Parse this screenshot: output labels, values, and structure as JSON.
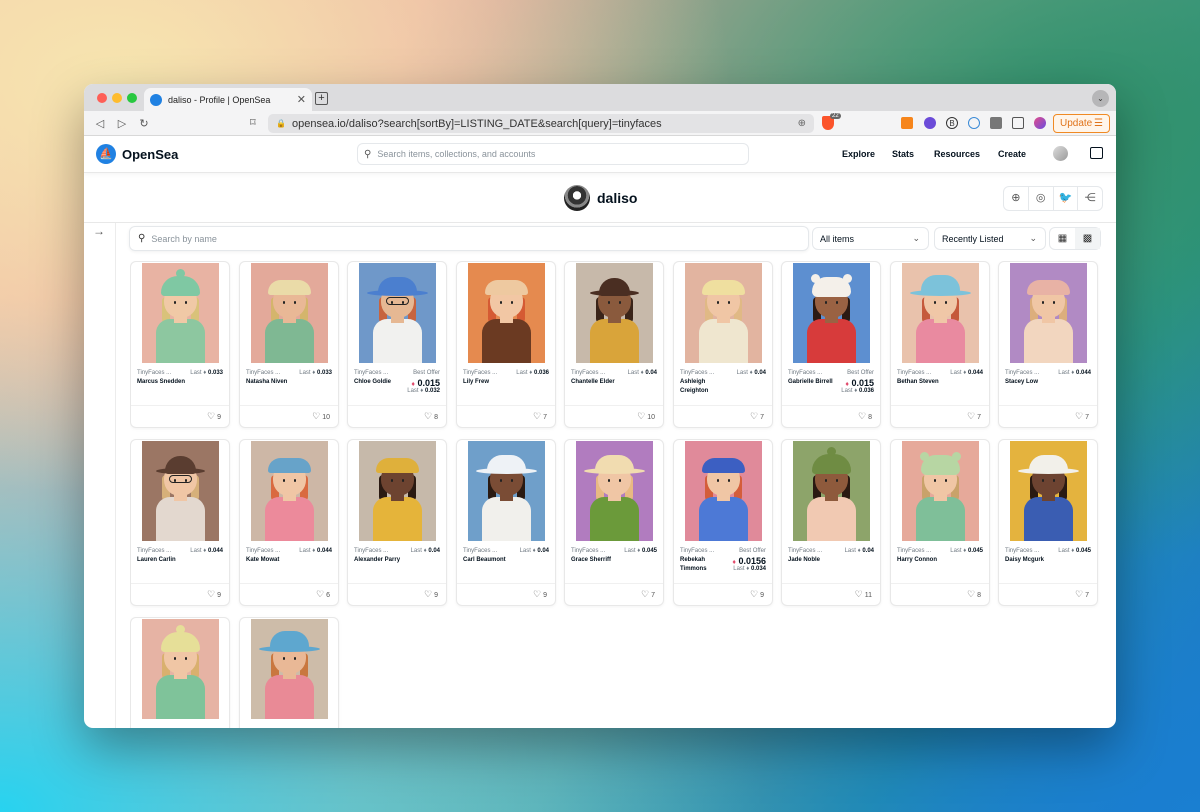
{
  "browser": {
    "tab_title": "daliso - Profile | OpenSea",
    "tab_close": "✕",
    "new_tab": "+",
    "url": "opensea.io/daliso?search[sortBy]=LISTING_DATE&search[query]=tinyfaces",
    "brave_count": "22",
    "update_label": "Update",
    "menu_glyph": "☰",
    "ext_b_letter": "B"
  },
  "header": {
    "brand": "OpenSea",
    "search_placeholder": "Search items, collections, and accounts",
    "nav": [
      "Explore",
      "Stats",
      "Resources",
      "Create"
    ]
  },
  "profile": {
    "name": "daliso"
  },
  "filters": {
    "search_placeholder": "Search by name",
    "items_filter": "All items",
    "sort": "Recently Listed"
  },
  "icons": {
    "back": "◁",
    "forward": "▷",
    "reload": "↻",
    "bookmark": "⌑",
    "lock": "🔒",
    "zoom": "⊕",
    "search": "⚲",
    "globe": "⊕",
    "instagram": "◎",
    "twitter": "🐦",
    "share": "⋲",
    "expand": "→",
    "chevron": "⌄",
    "heart": "♡",
    "eth": "♦",
    "tab_menu": "⌄",
    "grid_large": "▦",
    "grid_small": "▩"
  },
  "card_labels": {
    "last": "Last",
    "best_offer": "Best Offer"
  },
  "cards": [
    {
      "collection": "TinyFaces ...",
      "name": "Marcus Snedden",
      "type": "last",
      "price": "0.033",
      "likes": "9",
      "bg": "#e8b3a3",
      "skin": "#f0c9a6",
      "shirt": "#8dc7a0",
      "hair": "#d9c27a",
      "hat": "#7fc8a3",
      "hatStyle": "beanie"
    },
    {
      "collection": "TinyFaces ...",
      "name": "Natasha Niven",
      "type": "last",
      "price": "0.033",
      "likes": "10",
      "bg": "#e3a99a",
      "skin": "#e9b896",
      "shirt": "#7fb893",
      "hair": "#d4b56c",
      "hat": "#eadba8",
      "hatStyle": "beret"
    },
    {
      "collection": "TinyFaces ...",
      "name": "Chloe Goldie",
      "type": "offer",
      "price": "0.015",
      "sub": "0.032",
      "likes": "8",
      "bg": "#6f98c9",
      "skin": "#e6b893",
      "shirt": "#f1f1ef",
      "hair": "#c7643f",
      "hat": "#4b7fcf",
      "hatStyle": "wide",
      "glasses": true
    },
    {
      "collection": "TinyFaces ...",
      "name": "Lily Frew",
      "type": "last",
      "price": "0.036",
      "likes": "7",
      "bg": "#e58a4f",
      "skin": "#f2c7a4",
      "shirt": "#6b3a22",
      "hair": "#d55a33",
      "hat": "#eec9a0",
      "hatStyle": "cap"
    },
    {
      "collection": "TinyFaces ...",
      "name": "Chantelle Elder",
      "type": "last",
      "price": "0.04",
      "likes": "10",
      "bg": "#c7b9aa",
      "skin": "#8a5a3d",
      "shirt": "#d9a43a",
      "hair": "#3a2419",
      "hat": "#4a2e22",
      "hatStyle": "bowler"
    },
    {
      "collection": "TinyFaces ...",
      "name": "Ashleigh Creighton",
      "type": "last",
      "price": "0.04",
      "likes": "7",
      "bg": "#e2b4a0",
      "skin": "#f0c6a5",
      "shirt": "#efe6cf",
      "hair": "#e0b985",
      "hat": "#efdf9f",
      "hatStyle": "cap"
    },
    {
      "collection": "TinyFaces ...",
      "name": "Gabrielle Birrell",
      "type": "offer",
      "price": "0.015",
      "sub": "0.036",
      "likes": "8",
      "bg": "#5d8fd0",
      "skin": "#9a6243",
      "shirt": "#d73b3b",
      "hair": "#2b1a13",
      "hat": "#f4f0ea",
      "hatStyle": "bear"
    },
    {
      "collection": "TinyFaces ...",
      "name": "Bethan Steven",
      "type": "last",
      "price": "0.044",
      "likes": "7",
      "bg": "#e9c2ac",
      "skin": "#f0c7a7",
      "shirt": "#e98aa0",
      "hair": "#c5593b",
      "hat": "#7cc2da",
      "hatStyle": "bucket"
    },
    {
      "collection": "TinyFaces ...",
      "name": "Stacey Low",
      "type": "last",
      "price": "0.044",
      "likes": "7",
      "bg": "#b18ac4",
      "skin": "#f0c6a5",
      "shirt": "#f2d6bf",
      "hair": "#dcae7c",
      "hat": "#e8b2a5",
      "hatStyle": "beret"
    },
    {
      "collection": "TinyFaces ...",
      "name": "Lauren Carlin",
      "type": "last",
      "price": "0.044",
      "likes": "9",
      "bg": "#9b7664",
      "skin": "#f0c6a5",
      "shirt": "#e3d8cf",
      "hair": "#d6b07a",
      "hat": "#5a3d30",
      "hatStyle": "bowler",
      "glasses": true
    },
    {
      "collection": "TinyFaces ...",
      "name": "Kate Mowat",
      "type": "last",
      "price": "0.044",
      "likes": "6",
      "bg": "#cdb7a6",
      "skin": "#f0c6a5",
      "shirt": "#ec8a9b",
      "hair": "#d96a40",
      "hat": "#67a3c9",
      "hatStyle": "beret"
    },
    {
      "collection": "TinyFaces ...",
      "name": "Alexander Parry",
      "type": "last",
      "price": "0.04",
      "likes": "9",
      "bg": "#c6b9aa",
      "skin": "#6d4330",
      "shirt": "#e5b43a",
      "hair": "#2a1a12",
      "hat": "#dfb03b",
      "hatStyle": "cap"
    },
    {
      "collection": "TinyFaces ...",
      "name": "Carl Beaumont",
      "type": "last",
      "price": "0.04",
      "likes": "9",
      "bg": "#6f9fca",
      "skin": "#7a4c35",
      "shirt": "#f1f0ec",
      "hair": "#2a1a12",
      "hat": "#eef2f6",
      "hatStyle": "wide"
    },
    {
      "collection": "TinyFaces ...",
      "name": "Grace Sherriff",
      "type": "last",
      "price": "0.045",
      "likes": "7",
      "bg": "#b17cbf",
      "skin": "#f0c6a5",
      "shirt": "#6b9a3a",
      "hair": "#e8b983",
      "hat": "#f1dcb0",
      "hatStyle": "wide"
    },
    {
      "collection": "TinyFaces ...",
      "name": "Rebekah Timmons",
      "type": "offer",
      "price": "0.0156",
      "sub": "0.034",
      "likes": "9",
      "bg": "#e08a9a",
      "skin": "#f0c6a5",
      "shirt": "#4d79d6",
      "hair": "#d45d3a",
      "hat": "#3c5fc2",
      "hatStyle": "beret"
    },
    {
      "collection": "TinyFaces ...",
      "name": "Jade Noble",
      "type": "last",
      "price": "0.04",
      "likes": "11",
      "bg": "#8da46a",
      "skin": "#8e5a3c",
      "shirt": "#f1c9b2",
      "hair": "#2a1a12",
      "hat": "#6f8c43",
      "hatStyle": "beanie"
    },
    {
      "collection": "TinyFaces ...",
      "name": "Harry Connon",
      "type": "last",
      "price": "0.045",
      "likes": "8",
      "bg": "#e6a99a",
      "skin": "#f0c6a5",
      "shirt": "#7fbf99",
      "hair": "#c9a26a",
      "hat": "#b7d6a3",
      "hatStyle": "bear"
    },
    {
      "collection": "TinyFaces ...",
      "name": "Daisy Mcgurk",
      "type": "last",
      "price": "0.045",
      "likes": "7",
      "bg": "#e4b33e",
      "skin": "#6d4331",
      "shirt": "#3a5db2",
      "hair": "#2a1a12",
      "hat": "#f2f0ea",
      "hatStyle": "wide"
    },
    {
      "collection": "",
      "name": "",
      "type": "none",
      "price": "",
      "likes": "",
      "bg": "#e6b3a4",
      "skin": "#f0c6a5",
      "shirt": "#7fc39a",
      "hair": "#d9b06e",
      "hat": "#e6df98",
      "hatStyle": "beanie"
    },
    {
      "collection": "",
      "name": "",
      "type": "none",
      "price": "",
      "likes": "",
      "bg": "#cdbca9",
      "skin": "#e9b896",
      "shirt": "#e98a96",
      "hair": "#c9773f",
      "hat": "#5ea7cf",
      "hatStyle": "bucket"
    }
  ]
}
